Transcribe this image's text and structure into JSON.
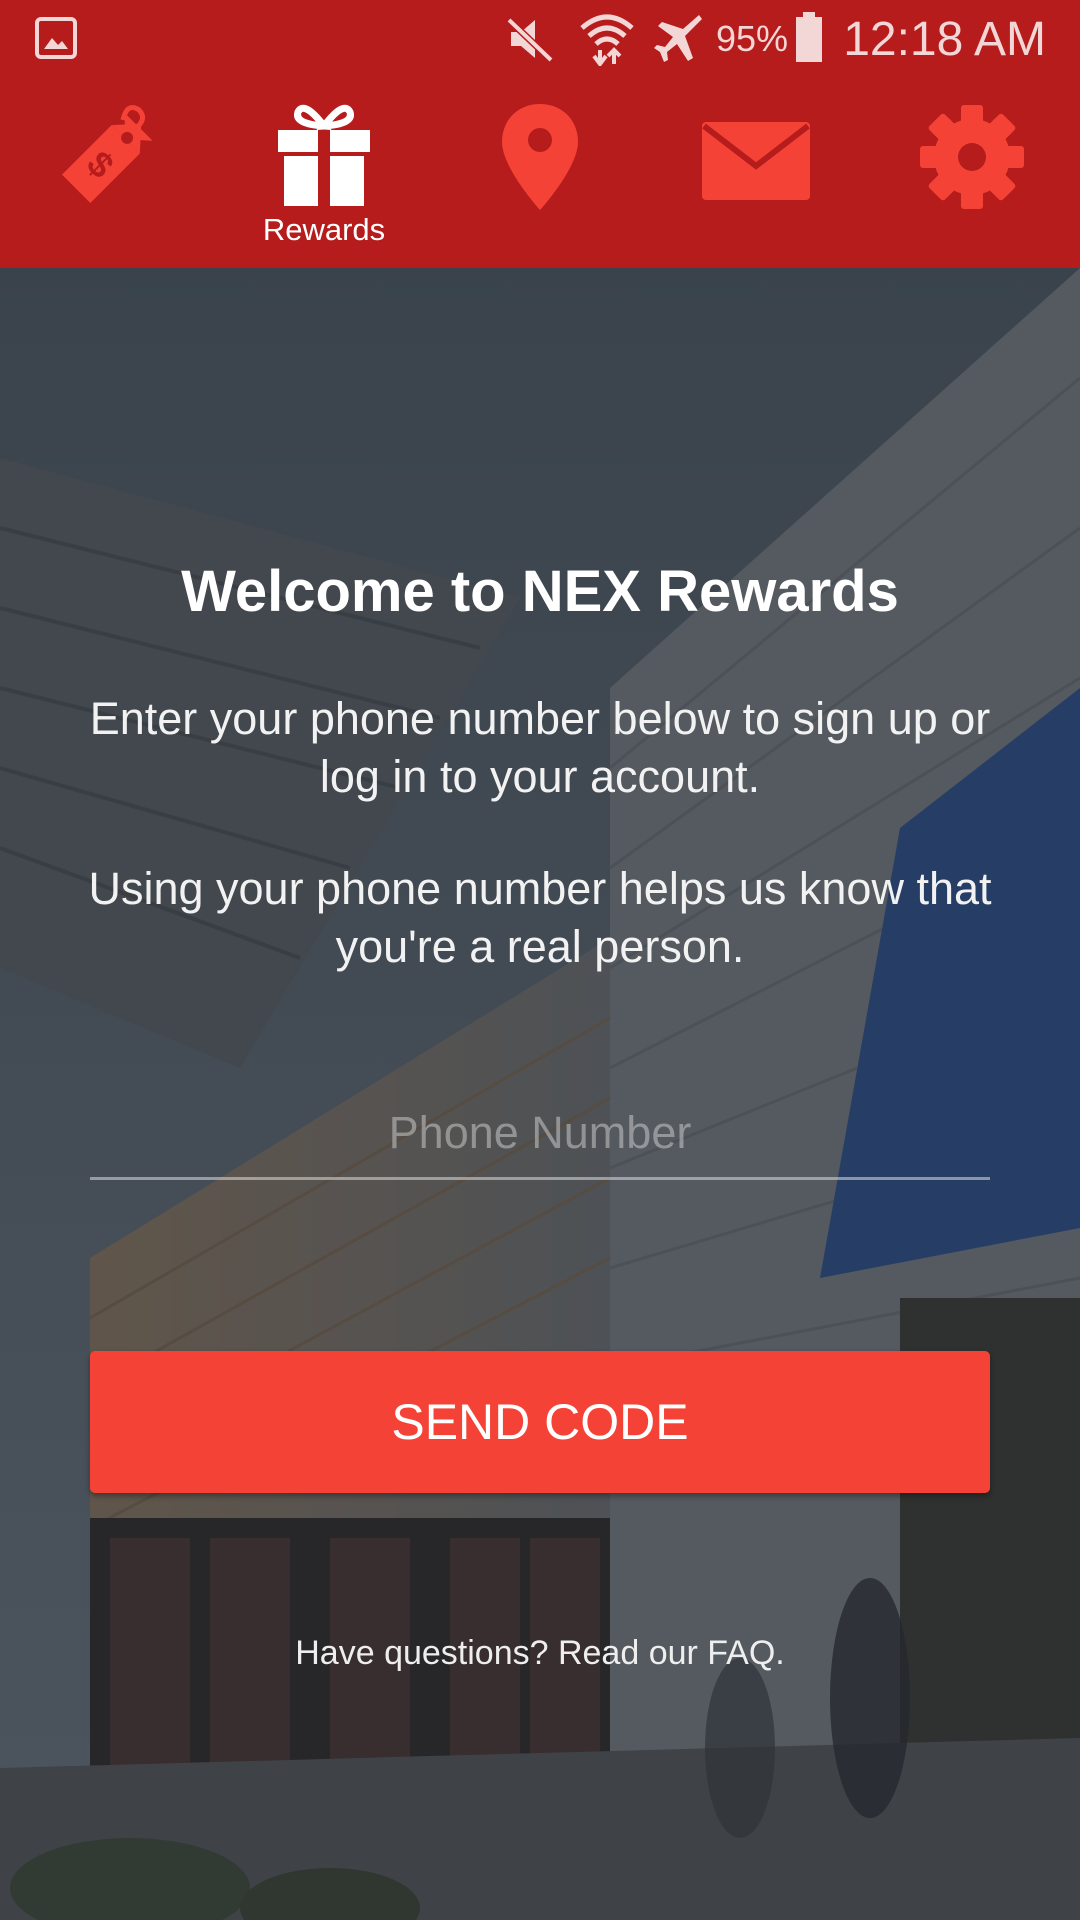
{
  "status_bar": {
    "battery_percent": "95%",
    "time": "12:18 AM",
    "icons": [
      "gallery-icon",
      "mute-icon",
      "wifi-icon",
      "airplane-icon",
      "battery-icon"
    ]
  },
  "nav": {
    "items": [
      {
        "icon": "price-tag-icon",
        "label": "",
        "active": false
      },
      {
        "icon": "gift-icon",
        "label": "Rewards",
        "active": true
      },
      {
        "icon": "location-pin-icon",
        "label": "",
        "active": false
      },
      {
        "icon": "envelope-icon",
        "label": "",
        "active": false
      },
      {
        "icon": "gear-icon",
        "label": "",
        "active": false
      }
    ]
  },
  "main": {
    "title": "Welcome to NEX Rewards",
    "intro_1": "Enter your phone number below to sign up or log in to your account.",
    "intro_2": "Using your phone number helps us know that you're a real person.",
    "phone_placeholder": "Phone Number",
    "phone_value": "",
    "send_button": "SEND CODE",
    "faq_text": "Have questions? Read our FAQ."
  },
  "colors": {
    "primary_dark": "#b71c1c",
    "accent": "#f44336",
    "inactive_icon": "#f44336",
    "active_icon": "#ffffff"
  }
}
